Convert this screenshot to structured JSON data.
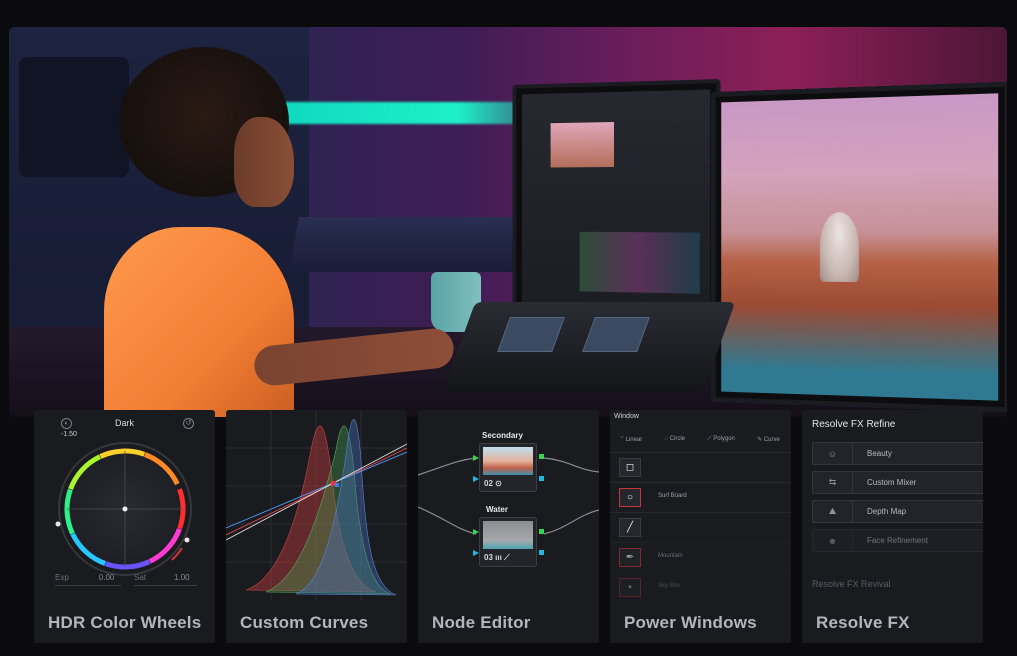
{
  "cards": {
    "hdr": {
      "label": "HDR Color Wheels",
      "wheel_title": "Dark",
      "value": "-1.50",
      "exp_label": "Exp",
      "exp_value": "0.00",
      "sat_label": "Sat",
      "sat_value": "1.00"
    },
    "curves": {
      "label": "Custom Curves"
    },
    "nodes": {
      "label": "Node Editor",
      "node1_title": "Secondary",
      "node1_id": "02",
      "node2_title": "Water",
      "node2_id": "03"
    },
    "power_windows": {
      "label": "Power Windows",
      "header": "Window",
      "tools": [
        "Linear",
        "Circle",
        "Polygon",
        "Curve"
      ],
      "rows": [
        "",
        "Surf Board",
        "",
        "Mountain",
        "Sky Blur"
      ]
    },
    "resolve_fx": {
      "label": "Resolve FX",
      "header": "Resolve FX Refine",
      "items": [
        "Beauty",
        "Custom Mixer",
        "Depth Map",
        "Face Refinement"
      ],
      "footer": "Resolve FX Revival"
    }
  },
  "colors": {
    "background": "#0b0b0d",
    "card": "#1a1b1f",
    "label": "#b4b6bd",
    "port_green": "#39d353",
    "port_cyan": "#24b8e0",
    "window_red": "#c8343b"
  }
}
